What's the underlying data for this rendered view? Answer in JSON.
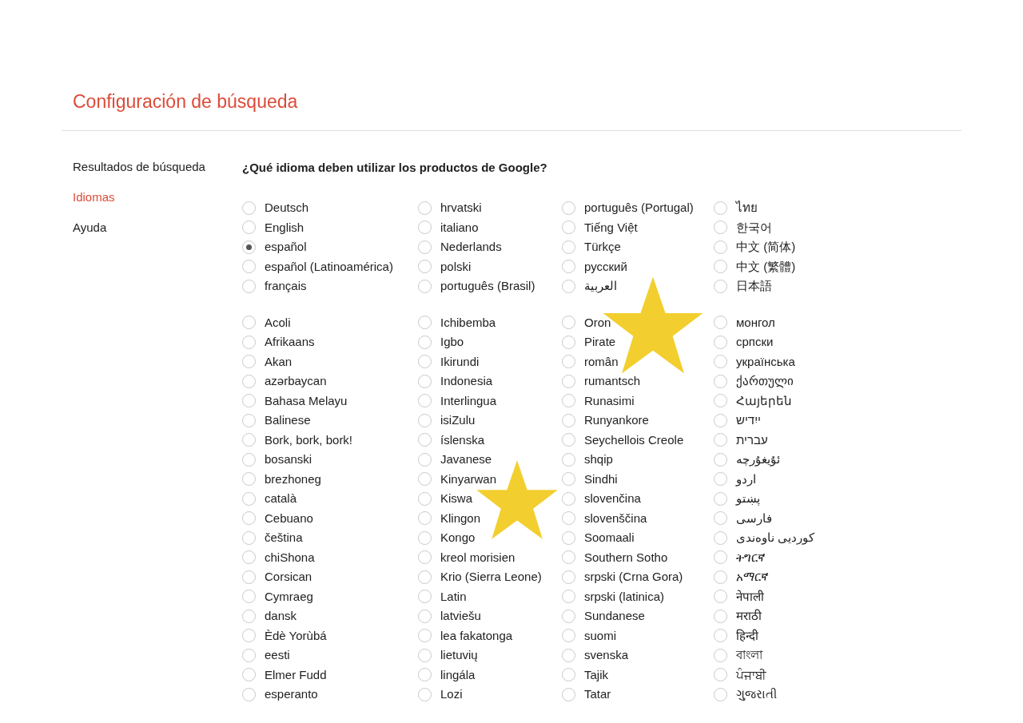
{
  "title": "Configuración de búsqueda",
  "sidebar": [
    {
      "label": "Resultados de búsqueda",
      "selected": false
    },
    {
      "label": "Idiomas",
      "selected": true
    },
    {
      "label": "Ayuda",
      "selected": false
    }
  ],
  "question": "¿Qué idioma deben utilizar los productos de Google?",
  "groups": [
    {
      "columns": [
        [
          {
            "label": "Deutsch",
            "selected": false
          },
          {
            "label": "English",
            "selected": false
          },
          {
            "label": "español",
            "selected": true
          },
          {
            "label": "español (Latinoamérica)",
            "selected": false
          },
          {
            "label": "français",
            "selected": false
          }
        ],
        [
          {
            "label": "hrvatski",
            "selected": false
          },
          {
            "label": "italiano",
            "selected": false
          },
          {
            "label": "Nederlands",
            "selected": false
          },
          {
            "label": "polski",
            "selected": false
          },
          {
            "label": "português (Brasil)",
            "selected": false
          }
        ],
        [
          {
            "label": "português (Portugal)",
            "selected": false
          },
          {
            "label": "Tiếng Việt",
            "selected": false
          },
          {
            "label": "Türkçe",
            "selected": false
          },
          {
            "label": "русский",
            "selected": false
          },
          {
            "label": "العربية",
            "selected": false
          }
        ],
        [
          {
            "label": "ไทย",
            "selected": false
          },
          {
            "label": "한국어",
            "selected": false
          },
          {
            "label": "中文 (简体)",
            "selected": false
          },
          {
            "label": "中文 (繁體)",
            "selected": false
          },
          {
            "label": "日本語",
            "selected": false
          }
        ]
      ]
    },
    {
      "columns": [
        [
          {
            "label": "Acoli",
            "selected": false
          },
          {
            "label": "Afrikaans",
            "selected": false
          },
          {
            "label": "Akan",
            "selected": false
          },
          {
            "label": "azərbaycan",
            "selected": false
          },
          {
            "label": "Bahasa Melayu",
            "selected": false
          },
          {
            "label": "Balinese",
            "selected": false
          },
          {
            "label": "Bork, bork, bork!",
            "selected": false
          },
          {
            "label": "bosanski",
            "selected": false
          },
          {
            "label": "brezhoneg",
            "selected": false
          },
          {
            "label": "català",
            "selected": false
          },
          {
            "label": "Cebuano",
            "selected": false
          },
          {
            "label": "čeština",
            "selected": false
          },
          {
            "label": "chiShona",
            "selected": false
          },
          {
            "label": "Corsican",
            "selected": false
          },
          {
            "label": "Cymraeg",
            "selected": false
          },
          {
            "label": "dansk",
            "selected": false
          },
          {
            "label": "Èdè Yorùbá",
            "selected": false
          },
          {
            "label": "eesti",
            "selected": false
          },
          {
            "label": "Elmer Fudd",
            "selected": false
          },
          {
            "label": "esperanto",
            "selected": false
          }
        ],
        [
          {
            "label": "Ichibemba",
            "selected": false
          },
          {
            "label": "Igbo",
            "selected": false
          },
          {
            "label": "Ikirundi",
            "selected": false
          },
          {
            "label": "Indonesia",
            "selected": false
          },
          {
            "label": "Interlingua",
            "selected": false
          },
          {
            "label": "isiZulu",
            "selected": false
          },
          {
            "label": "íslenska",
            "selected": false
          },
          {
            "label": "Javanese",
            "selected": false
          },
          {
            "label": "Kinyarwan",
            "selected": false
          },
          {
            "label": "Kiswa",
            "selected": false
          },
          {
            "label": "Klingon",
            "selected": false
          },
          {
            "label": "Kongo",
            "selected": false
          },
          {
            "label": "kreol morisien",
            "selected": false
          },
          {
            "label": "Krio (Sierra Leone)",
            "selected": false
          },
          {
            "label": "Latin",
            "selected": false
          },
          {
            "label": "latviešu",
            "selected": false
          },
          {
            "label": "lea fakatonga",
            "selected": false
          },
          {
            "label": "lietuvių",
            "selected": false
          },
          {
            "label": "lingála",
            "selected": false
          },
          {
            "label": "Lozi",
            "selected": false
          }
        ],
        [
          {
            "label": "Oron",
            "selected": false
          },
          {
            "label": "Pirate",
            "selected": false
          },
          {
            "label": "român",
            "selected": false
          },
          {
            "label": "rumantsch",
            "selected": false
          },
          {
            "label": "Runasimi",
            "selected": false
          },
          {
            "label": "Runyankore",
            "selected": false
          },
          {
            "label": "Seychellois Creole",
            "selected": false
          },
          {
            "label": "shqip",
            "selected": false
          },
          {
            "label": "Sindhi",
            "selected": false
          },
          {
            "label": "slovenčina",
            "selected": false
          },
          {
            "label": "slovenščina",
            "selected": false
          },
          {
            "label": "Soomaali",
            "selected": false
          },
          {
            "label": "Southern Sotho",
            "selected": false
          },
          {
            "label": "srpski (Crna Gora)",
            "selected": false
          },
          {
            "label": "srpski (latinica)",
            "selected": false
          },
          {
            "label": "Sundanese",
            "selected": false
          },
          {
            "label": "suomi",
            "selected": false
          },
          {
            "label": "svenska",
            "selected": false
          },
          {
            "label": "Tajik",
            "selected": false
          },
          {
            "label": "Tatar",
            "selected": false
          }
        ],
        [
          {
            "label": "монгол",
            "selected": false
          },
          {
            "label": "српски",
            "selected": false
          },
          {
            "label": "українська",
            "selected": false
          },
          {
            "label": "ქართული",
            "selected": false
          },
          {
            "label": "Հայերեն",
            "selected": false
          },
          {
            "label": "ייִדיש",
            "selected": false
          },
          {
            "label": "עברית",
            "selected": false
          },
          {
            "label": "ئۇيغۇرچە",
            "selected": false
          },
          {
            "label": "اردو",
            "selected": false
          },
          {
            "label": "پښتو",
            "selected": false
          },
          {
            "label": "فارسی",
            "selected": false
          },
          {
            "label": "کوردیی ناوەندی",
            "selected": false
          },
          {
            "label": "ትግርኛ",
            "selected": false
          },
          {
            "label": "አማርኛ",
            "selected": false
          },
          {
            "label": "नेपाली",
            "selected": false
          },
          {
            "label": "मराठी",
            "selected": false
          },
          {
            "label": "हिन्दी",
            "selected": false
          },
          {
            "label": "বাংলা",
            "selected": false
          },
          {
            "label": "ਪੰਜਾਬੀ",
            "selected": false
          },
          {
            "label": "ગુજરાતી",
            "selected": false
          }
        ]
      ]
    }
  ]
}
